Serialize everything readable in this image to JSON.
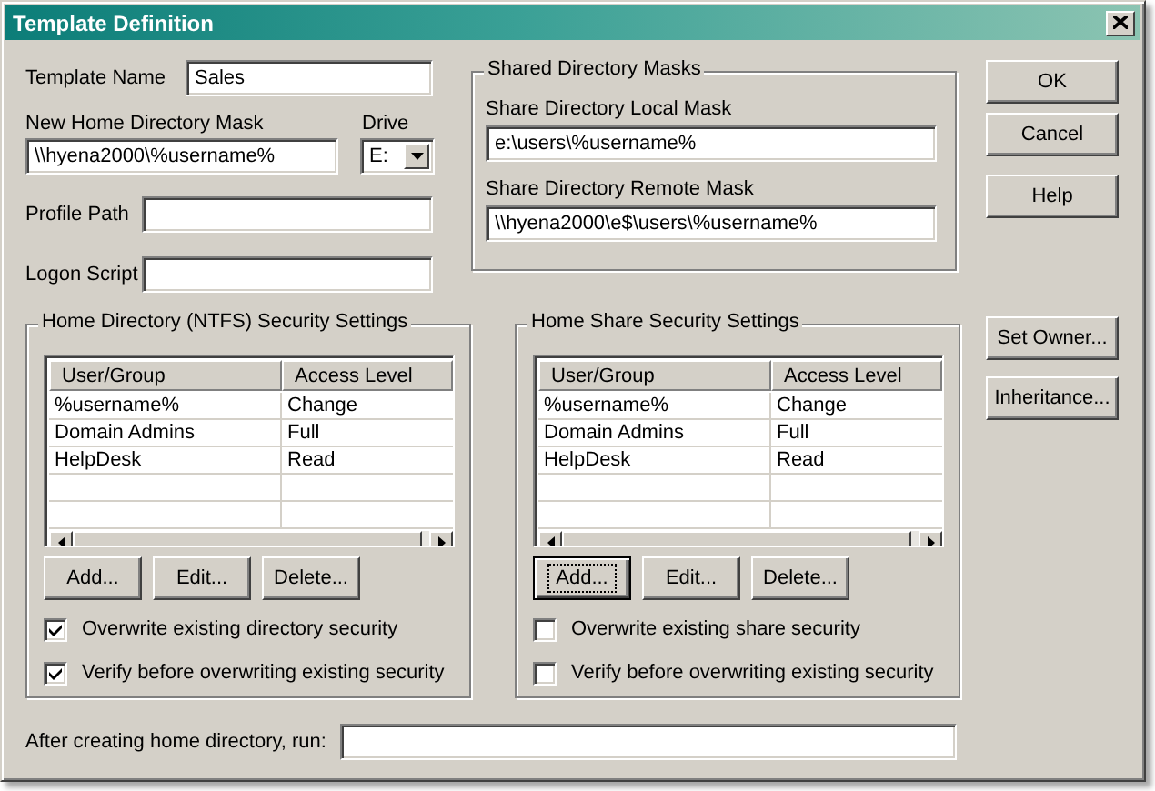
{
  "window": {
    "title": "Template Definition"
  },
  "template_name": {
    "label": "Template Name",
    "value": "Sales"
  },
  "home_mask": {
    "label": "New Home Directory Mask",
    "value": "\\\\hyena2000\\%username%"
  },
  "drive": {
    "label": "Drive",
    "value": "E:"
  },
  "profile_path": {
    "label": "Profile Path"
  },
  "logon_script": {
    "label": "Logon Script"
  },
  "shared_masks": {
    "title": "Shared Directory Masks",
    "fields": [
      {
        "label": "Share Directory Local Mask",
        "value": "e:\\users\\%username%"
      },
      {
        "label": "Share Directory Remote Mask",
        "value": "\\\\hyena2000\\e$\\users\\%username%"
      }
    ]
  },
  "dialog_buttons": [
    {
      "label": "OK"
    },
    {
      "label": "Cancel"
    },
    {
      "label": "Help"
    }
  ],
  "side_buttons": [
    {
      "label": "Set Owner..."
    },
    {
      "label": "Inheritance..."
    }
  ],
  "security_groups": [
    {
      "title": "Home Directory (NTFS) Security Settings",
      "columns": [
        "User/Group",
        "Access Level"
      ],
      "rows": [
        [
          "%username%",
          "Change"
        ],
        [
          "Domain Admins",
          "Full"
        ],
        [
          "HelpDesk",
          "Read"
        ]
      ],
      "buttons": [
        {
          "label": "Add...",
          "focused": false
        },
        {
          "label": "Edit...",
          "focused": false
        },
        {
          "label": "Delete...",
          "focused": false
        }
      ],
      "options": [
        {
          "label": "Overwrite existing directory security",
          "checked": true
        },
        {
          "label": "Verify before overwriting existing security",
          "checked": true
        }
      ]
    },
    {
      "title": "Home Share Security Settings",
      "columns": [
        "User/Group",
        "Access Level"
      ],
      "rows": [
        [
          "%username%",
          "Change"
        ],
        [
          "Domain Admins",
          "Full"
        ],
        [
          "HelpDesk",
          "Read"
        ]
      ],
      "buttons": [
        {
          "label": "Add...",
          "focused": true
        },
        {
          "label": "Edit...",
          "focused": false
        },
        {
          "label": "Delete...",
          "focused": false
        }
      ],
      "options": [
        {
          "label": "Overwrite existing share security",
          "checked": false
        },
        {
          "label": "Verify before overwriting existing security",
          "checked": false
        }
      ]
    }
  ],
  "after_run": {
    "label": "After creating home directory, run:"
  }
}
